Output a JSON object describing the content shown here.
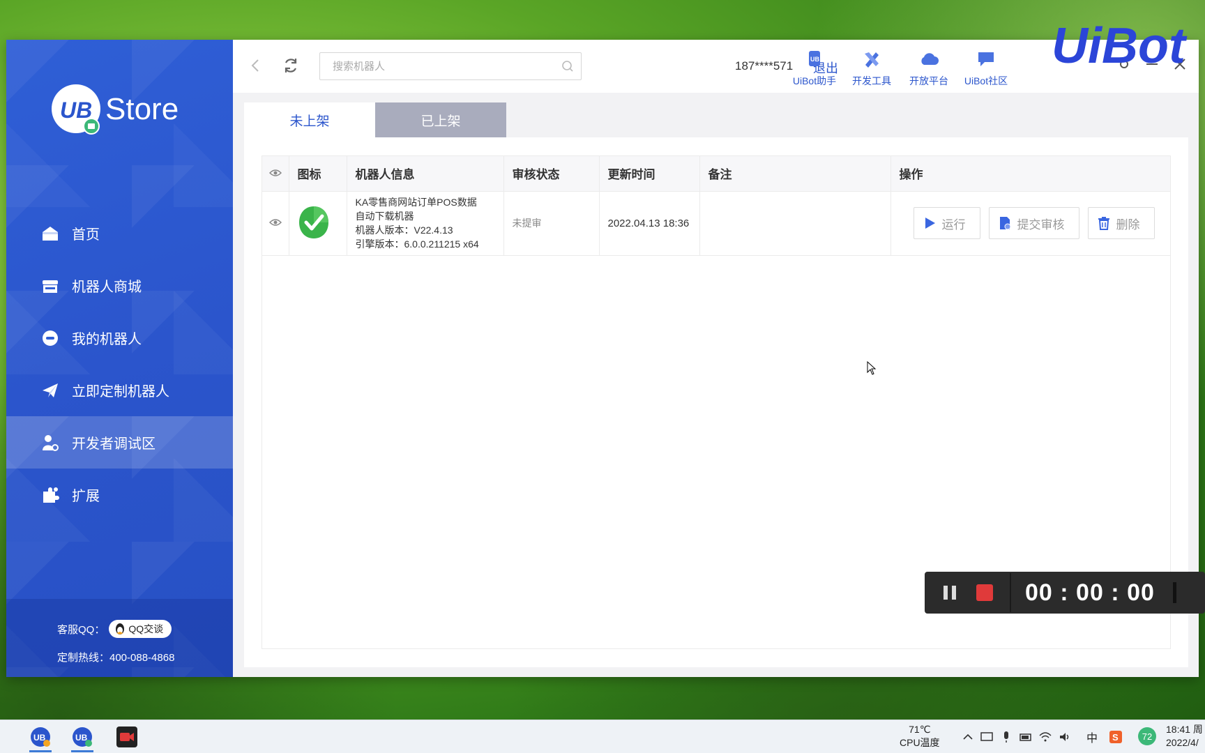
{
  "app": {
    "brand": "Store",
    "brand_mark": "UB",
    "watermark": "UiBot"
  },
  "sidebar": {
    "items": [
      {
        "label": "首页",
        "icon": "home-icon"
      },
      {
        "label": "机器人商城",
        "icon": "store-icon"
      },
      {
        "label": "我的机器人",
        "icon": "robot-icon"
      },
      {
        "label": "立即定制机器人",
        "icon": "paper-plane-icon"
      },
      {
        "label": "开发者调试区",
        "icon": "developer-icon",
        "active": true
      },
      {
        "label": "扩展",
        "icon": "puzzle-icon"
      }
    ],
    "footer": {
      "qq_label": "客服QQ：",
      "qq_button": "QQ交谈",
      "hotline": "定制热线：400-088-4868"
    }
  },
  "topbar": {
    "search_placeholder": "搜索机器人",
    "phone": "187****571",
    "logout": "退出",
    "tools": [
      {
        "label": "UiBot助手",
        "icon": "uibot-assistant-icon"
      },
      {
        "label": "开发工具",
        "icon": "dev-tools-icon"
      },
      {
        "label": "开放平台",
        "icon": "cloud-icon"
      },
      {
        "label": "UiBot社区",
        "icon": "chat-icon"
      }
    ]
  },
  "tabs": [
    {
      "label": "未上架",
      "active": true
    },
    {
      "label": "已上架",
      "active": false
    }
  ],
  "table": {
    "headers": [
      "图标",
      "机器人信息",
      "审核状态",
      "更新时间",
      "备注",
      "操作"
    ],
    "rows": [
      {
        "name_line1": "KA零售商网站订单POS数据",
        "name_line2": "自动下载机器",
        "version": "机器人版本：V22.4.13",
        "engine": "引擎版本：6.0.0.211215 x64",
        "status": "未提审",
        "updated": "2022.04.13 18:36",
        "note": "",
        "actions": {
          "run": "运行",
          "submit": "提交审核",
          "delete": "删除"
        }
      }
    ]
  },
  "recorder": {
    "time": "00 : 00 : 00"
  },
  "taskbar": {
    "cpu_temp": "71℃",
    "cpu_label": "CPU温度",
    "ime": "中",
    "badge": "72",
    "time": "18:41 周",
    "date": "2022/4/"
  },
  "colors": {
    "accent": "#2b55cc",
    "sidebar": "#2f5fd6",
    "inactive_tab": "#a9acbd",
    "record_stop": "#e03a3a"
  }
}
